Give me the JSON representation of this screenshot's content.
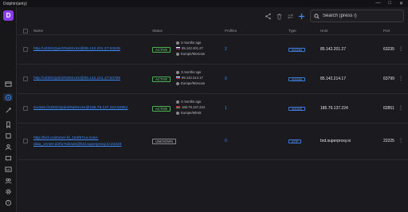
{
  "window": {
    "title": "Dolphin{anty}",
    "minimize": "—",
    "maximize": "□",
    "close": "✕"
  },
  "logo": "D",
  "search": {
    "placeholder": "Search (press /)"
  },
  "columns": {
    "name": "Name",
    "status": "Status",
    "profiles": "Profiles",
    "type": "Type",
    "host": "Host",
    "port": "Port"
  },
  "rows": [
    {
      "name": "http://oZDiGQukGRahSxXe@85.142.201.27:63235",
      "status": "ACTIVE",
      "checked_ago": "3 months ago",
      "ip": "85.142.201.27",
      "location": "Europe/Moscow",
      "profiles": "2",
      "type": "SOCKS5",
      "host": "85.142.201.27",
      "port": "63235",
      "more": "⋮"
    },
    {
      "name": "http://oZDiGQukGRahSxXe@85.142.214.17:63799",
      "status": "ACTIVE",
      "checked_ago": "3 months ago",
      "ip": "85.142.214.17",
      "location": "Europe/Moscow",
      "profiles": "0",
      "type": "SOCKS5",
      "host": "85.142.214.17",
      "port": "63799",
      "more": "⋮"
    },
    {
      "name": "socks5://oZDiGQukGRahSxXe@185.79.137.224:62851",
      "status": "ACTIVE",
      "checked_ago": "3 months ago",
      "ip": "185.79.137.224",
      "location": "Europe/Minsk",
      "profiles": "1",
      "type": "SOCKS5",
      "host": "185.79.137.224",
      "port": "62851",
      "more": "⋮"
    },
    {
      "name": "http://brd-customer-hl_154f57ca-zone-data_center:d2Ifu7tdzsah@brd.superproxy.io:22225",
      "status": "UNKNOWN",
      "profiles": "0",
      "type": "HTTP",
      "host": "brd.superproxy.io",
      "port": "22225",
      "more": "⋮"
    }
  ],
  "colors": {
    "accent": "#3b8bff",
    "active": "#4caf50",
    "brand": "#8b3ee8"
  }
}
